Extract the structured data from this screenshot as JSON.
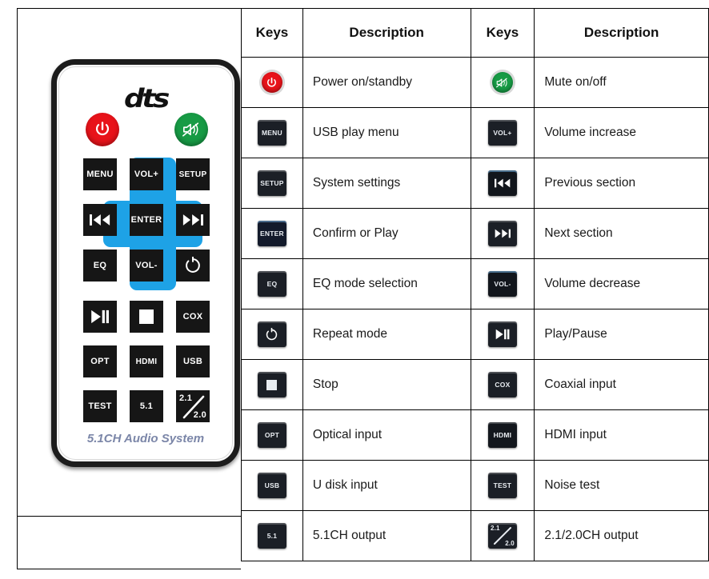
{
  "remote": {
    "brand_logo": "dts",
    "tagline": "5.1CH  Audio System",
    "round_buttons": [
      {
        "name": "power",
        "label": "",
        "icon": "power-icon",
        "color": "#e8131a"
      },
      {
        "name": "mute",
        "label": "",
        "icon": "mute-icon",
        "color": "#179b45"
      }
    ],
    "keys": [
      {
        "name": "menu",
        "label": "MENU"
      },
      {
        "name": "vol-up",
        "label": "VOL+"
      },
      {
        "name": "setup",
        "label": "SETUP"
      },
      {
        "name": "prev",
        "label": "",
        "icon": "previous-track-icon"
      },
      {
        "name": "enter",
        "label": "ENTER"
      },
      {
        "name": "next",
        "label": "",
        "icon": "next-track-icon"
      },
      {
        "name": "eq",
        "label": "EQ"
      },
      {
        "name": "vol-down",
        "label": "VOL-"
      },
      {
        "name": "repeat",
        "label": "",
        "icon": "repeat-icon"
      },
      {
        "name": "play-pause",
        "label": "",
        "icon": "play-pause-icon"
      },
      {
        "name": "stop",
        "label": "",
        "icon": "stop-icon"
      },
      {
        "name": "cox",
        "label": "COX"
      },
      {
        "name": "opt",
        "label": "OPT"
      },
      {
        "name": "hdmi",
        "label": "HDMI"
      },
      {
        "name": "usb",
        "label": "USB"
      },
      {
        "name": "test",
        "label": "TEST"
      },
      {
        "name": "ch51",
        "label": "5.1"
      },
      {
        "name": "ch21",
        "label": "2.1/2.0",
        "label_top": "2.1",
        "label_bottom": "2.0"
      }
    ],
    "dpad_color": "#1ea2e6"
  },
  "table": {
    "headers": {
      "keys_1": "Keys",
      "description_1": "Description",
      "keys_2": "Keys",
      "description_2": "Description"
    },
    "rows": [
      {
        "left": {
          "key": "power",
          "key_label": "",
          "icon": "power-icon",
          "desc": "Power on/standby"
        },
        "right": {
          "key": "mute",
          "key_label": "",
          "icon": "mute-icon",
          "desc": "Mute on/off"
        }
      },
      {
        "left": {
          "key": "menu",
          "key_label": "MENU",
          "icon": "menu-key-icon",
          "desc": "USB play menu"
        },
        "right": {
          "key": "vol-up",
          "key_label": "VOL+",
          "icon": "volume-up-key-icon",
          "desc": "Volume increase"
        }
      },
      {
        "left": {
          "key": "setup",
          "key_label": "SETUP",
          "icon": "setup-key-icon",
          "desc": "System settings"
        },
        "right": {
          "key": "prev",
          "key_label": "",
          "icon": "previous-track-icon",
          "desc": "Previous section"
        }
      },
      {
        "left": {
          "key": "enter",
          "key_label": "ENTER",
          "icon": "enter-key-icon",
          "desc": "Confirm or Play"
        },
        "right": {
          "key": "next",
          "key_label": "",
          "icon": "next-track-icon",
          "desc": "Next section"
        }
      },
      {
        "left": {
          "key": "eq",
          "key_label": "EQ",
          "icon": "eq-key-icon",
          "desc": "EQ mode selection"
        },
        "right": {
          "key": "vol-down",
          "key_label": "VOL-",
          "icon": "volume-down-key-icon",
          "desc": "Volume decrease"
        }
      },
      {
        "left": {
          "key": "repeat",
          "key_label": "",
          "icon": "repeat-icon",
          "desc": "Repeat mode"
        },
        "right": {
          "key": "play-pause",
          "key_label": "",
          "icon": "play-pause-icon",
          "desc": "Play/Pause"
        }
      },
      {
        "left": {
          "key": "stop",
          "key_label": "",
          "icon": "stop-icon",
          "desc": "Stop"
        },
        "right": {
          "key": "cox",
          "key_label": "COX",
          "icon": "coaxial-key-icon",
          "desc": "Coaxial input"
        }
      },
      {
        "left": {
          "key": "opt",
          "key_label": "OPT",
          "icon": "optical-key-icon",
          "desc": "Optical input"
        },
        "right": {
          "key": "hdmi",
          "key_label": "HDMI",
          "icon": "hdmi-key-icon",
          "desc": "HDMI input"
        }
      },
      {
        "left": {
          "key": "usb",
          "key_label": "USB",
          "icon": "usb-key-icon",
          "desc": "U disk input"
        },
        "right": {
          "key": "test",
          "key_label": "TEST",
          "icon": "test-key-icon",
          "desc": "Noise test"
        }
      },
      {
        "left": {
          "key": "ch51",
          "key_label": "5.1",
          "icon": "ch51-key-icon",
          "desc": "5.1CH output"
        },
        "right": {
          "key": "ch21",
          "key_label": "2.1/2.0",
          "icon": "ch21-key-icon",
          "desc": "2.1/2.0CH output"
        }
      }
    ]
  },
  "colors": {
    "power_red": "#e8131a",
    "mute_green": "#179b45",
    "dpad_blue": "#1ea2e6",
    "key_black": "#161616",
    "tagline_blue_grey": "#7b86a8"
  }
}
